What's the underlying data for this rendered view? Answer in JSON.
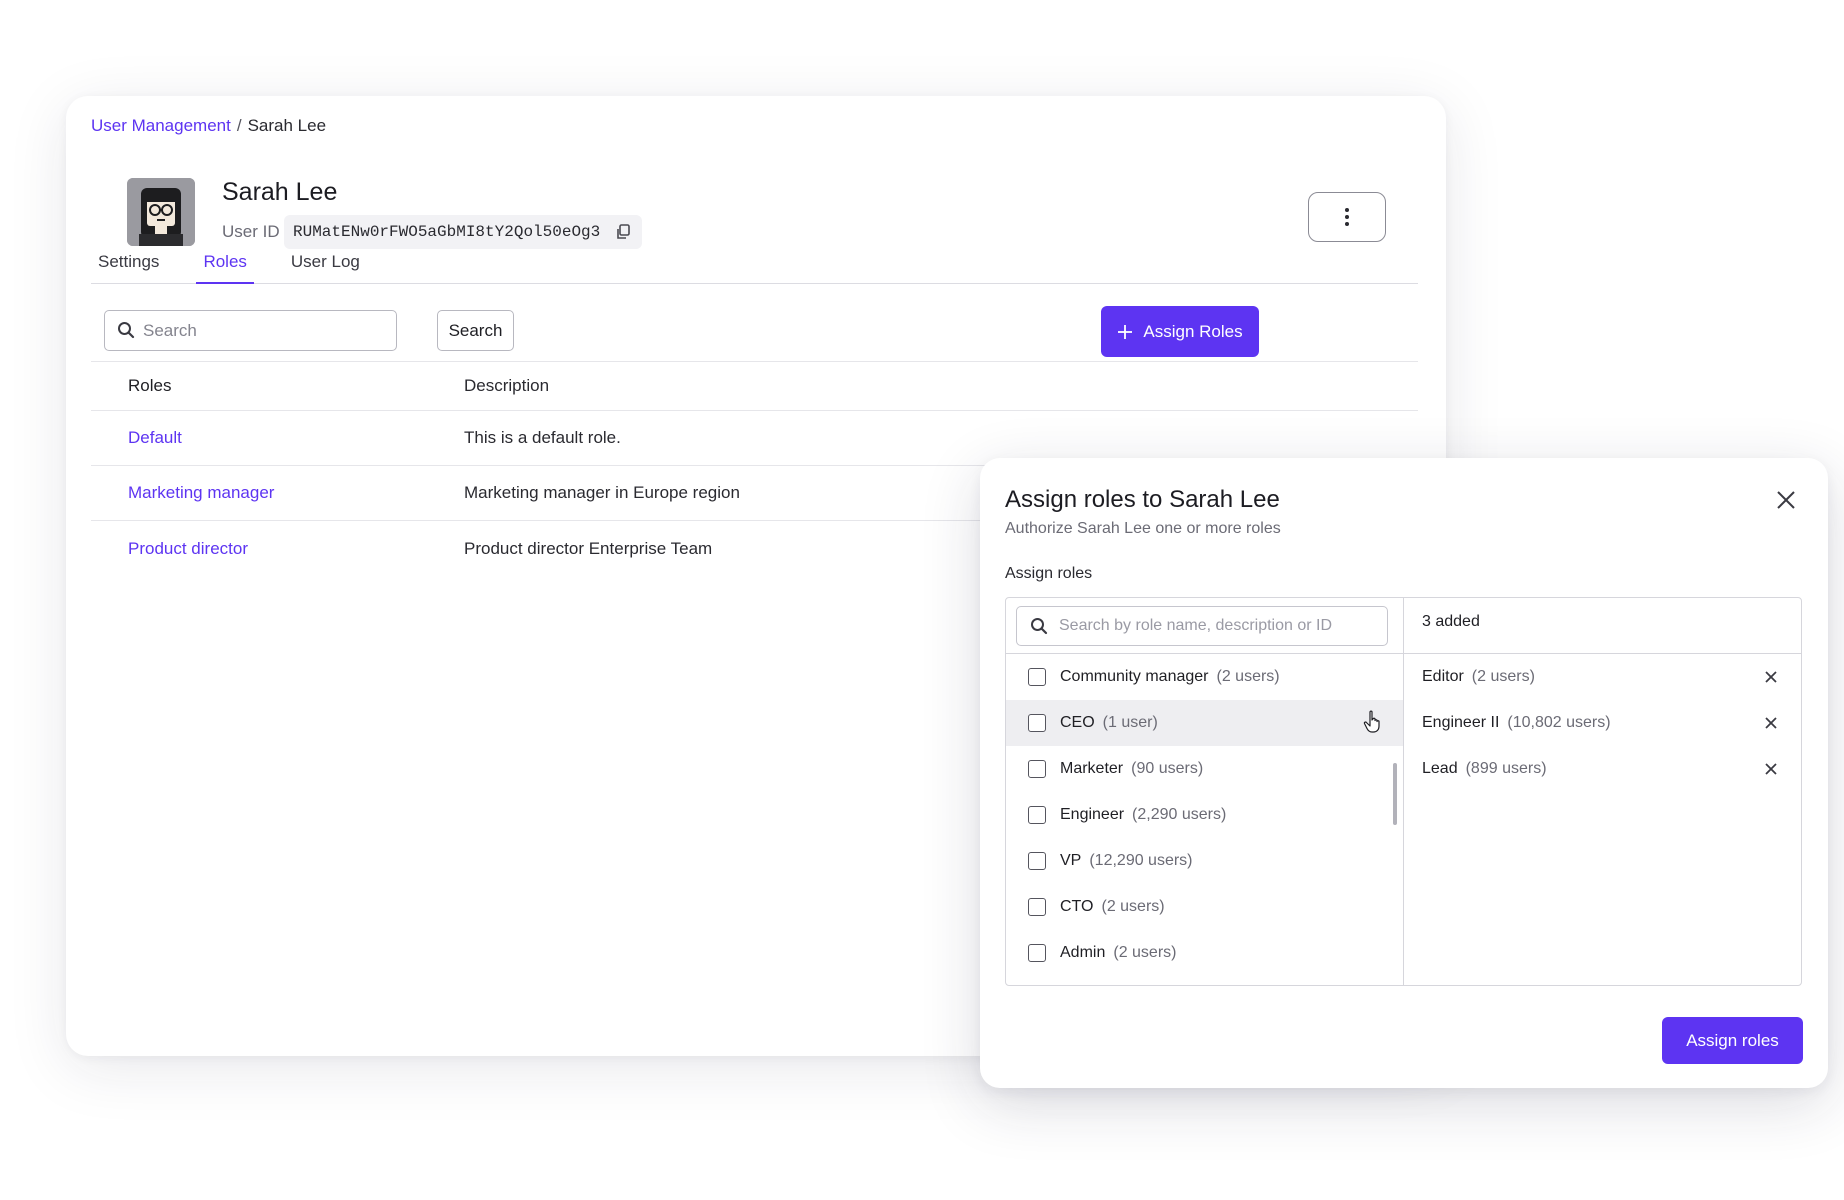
{
  "breadcrumb": {
    "parent": "User Management",
    "separator": "/",
    "current": "Sarah Lee"
  },
  "profile": {
    "name": "Sarah Lee",
    "user_id_label": "User ID",
    "user_id": "RUMatENw0rFWO5aGbMI8tY2Qol50eOg3"
  },
  "tabs": [
    {
      "label": "Settings",
      "active": false
    },
    {
      "label": "Roles",
      "active": true
    },
    {
      "label": "User Log",
      "active": false
    }
  ],
  "toolbar": {
    "search_placeholder": "Search",
    "search_button": "Search",
    "assign_button": "Assign Roles"
  },
  "roles_table": {
    "headers": {
      "role": "Roles",
      "description": "Description"
    },
    "rows": [
      {
        "role": "Default",
        "description": "This is a default role."
      },
      {
        "role": "Marketing manager",
        "description": "Marketing manager in Europe region"
      },
      {
        "role": "Product director",
        "description": "Product director Enterprise Team"
      }
    ]
  },
  "modal": {
    "title": "Assign roles to Sarah Lee",
    "subtitle": "Authorize Sarah Lee one or more roles",
    "section_label": "Assign roles",
    "search_placeholder": "Search by role name, description or ID",
    "available_roles": [
      {
        "name": "Community manager",
        "count": "(2 users)"
      },
      {
        "name": "CEO",
        "count": "(1 user)"
      },
      {
        "name": "Marketer",
        "count": "(90 users)"
      },
      {
        "name": "Engineer",
        "count": "(2,290 users)"
      },
      {
        "name": "VP",
        "count": "(12,290 users)"
      },
      {
        "name": "CTO",
        "count": "(2 users)"
      },
      {
        "name": "Admin",
        "count": "(2 users)"
      }
    ],
    "added_count": "3 added",
    "added_roles": [
      {
        "name": "Editor",
        "count": "(2 users)"
      },
      {
        "name": "Engineer II",
        "count": "(10,802 users)"
      },
      {
        "name": "Lead",
        "count": "(899 users)"
      }
    ],
    "submit_button": "Assign roles"
  },
  "colors": {
    "accent": "#5d34f2"
  },
  "icons": [
    "copy-icon",
    "more-vertical-icon",
    "search-icon",
    "plus-icon",
    "close-icon",
    "checkbox-icon",
    "hand-pointer-icon",
    "remove-icon"
  ]
}
